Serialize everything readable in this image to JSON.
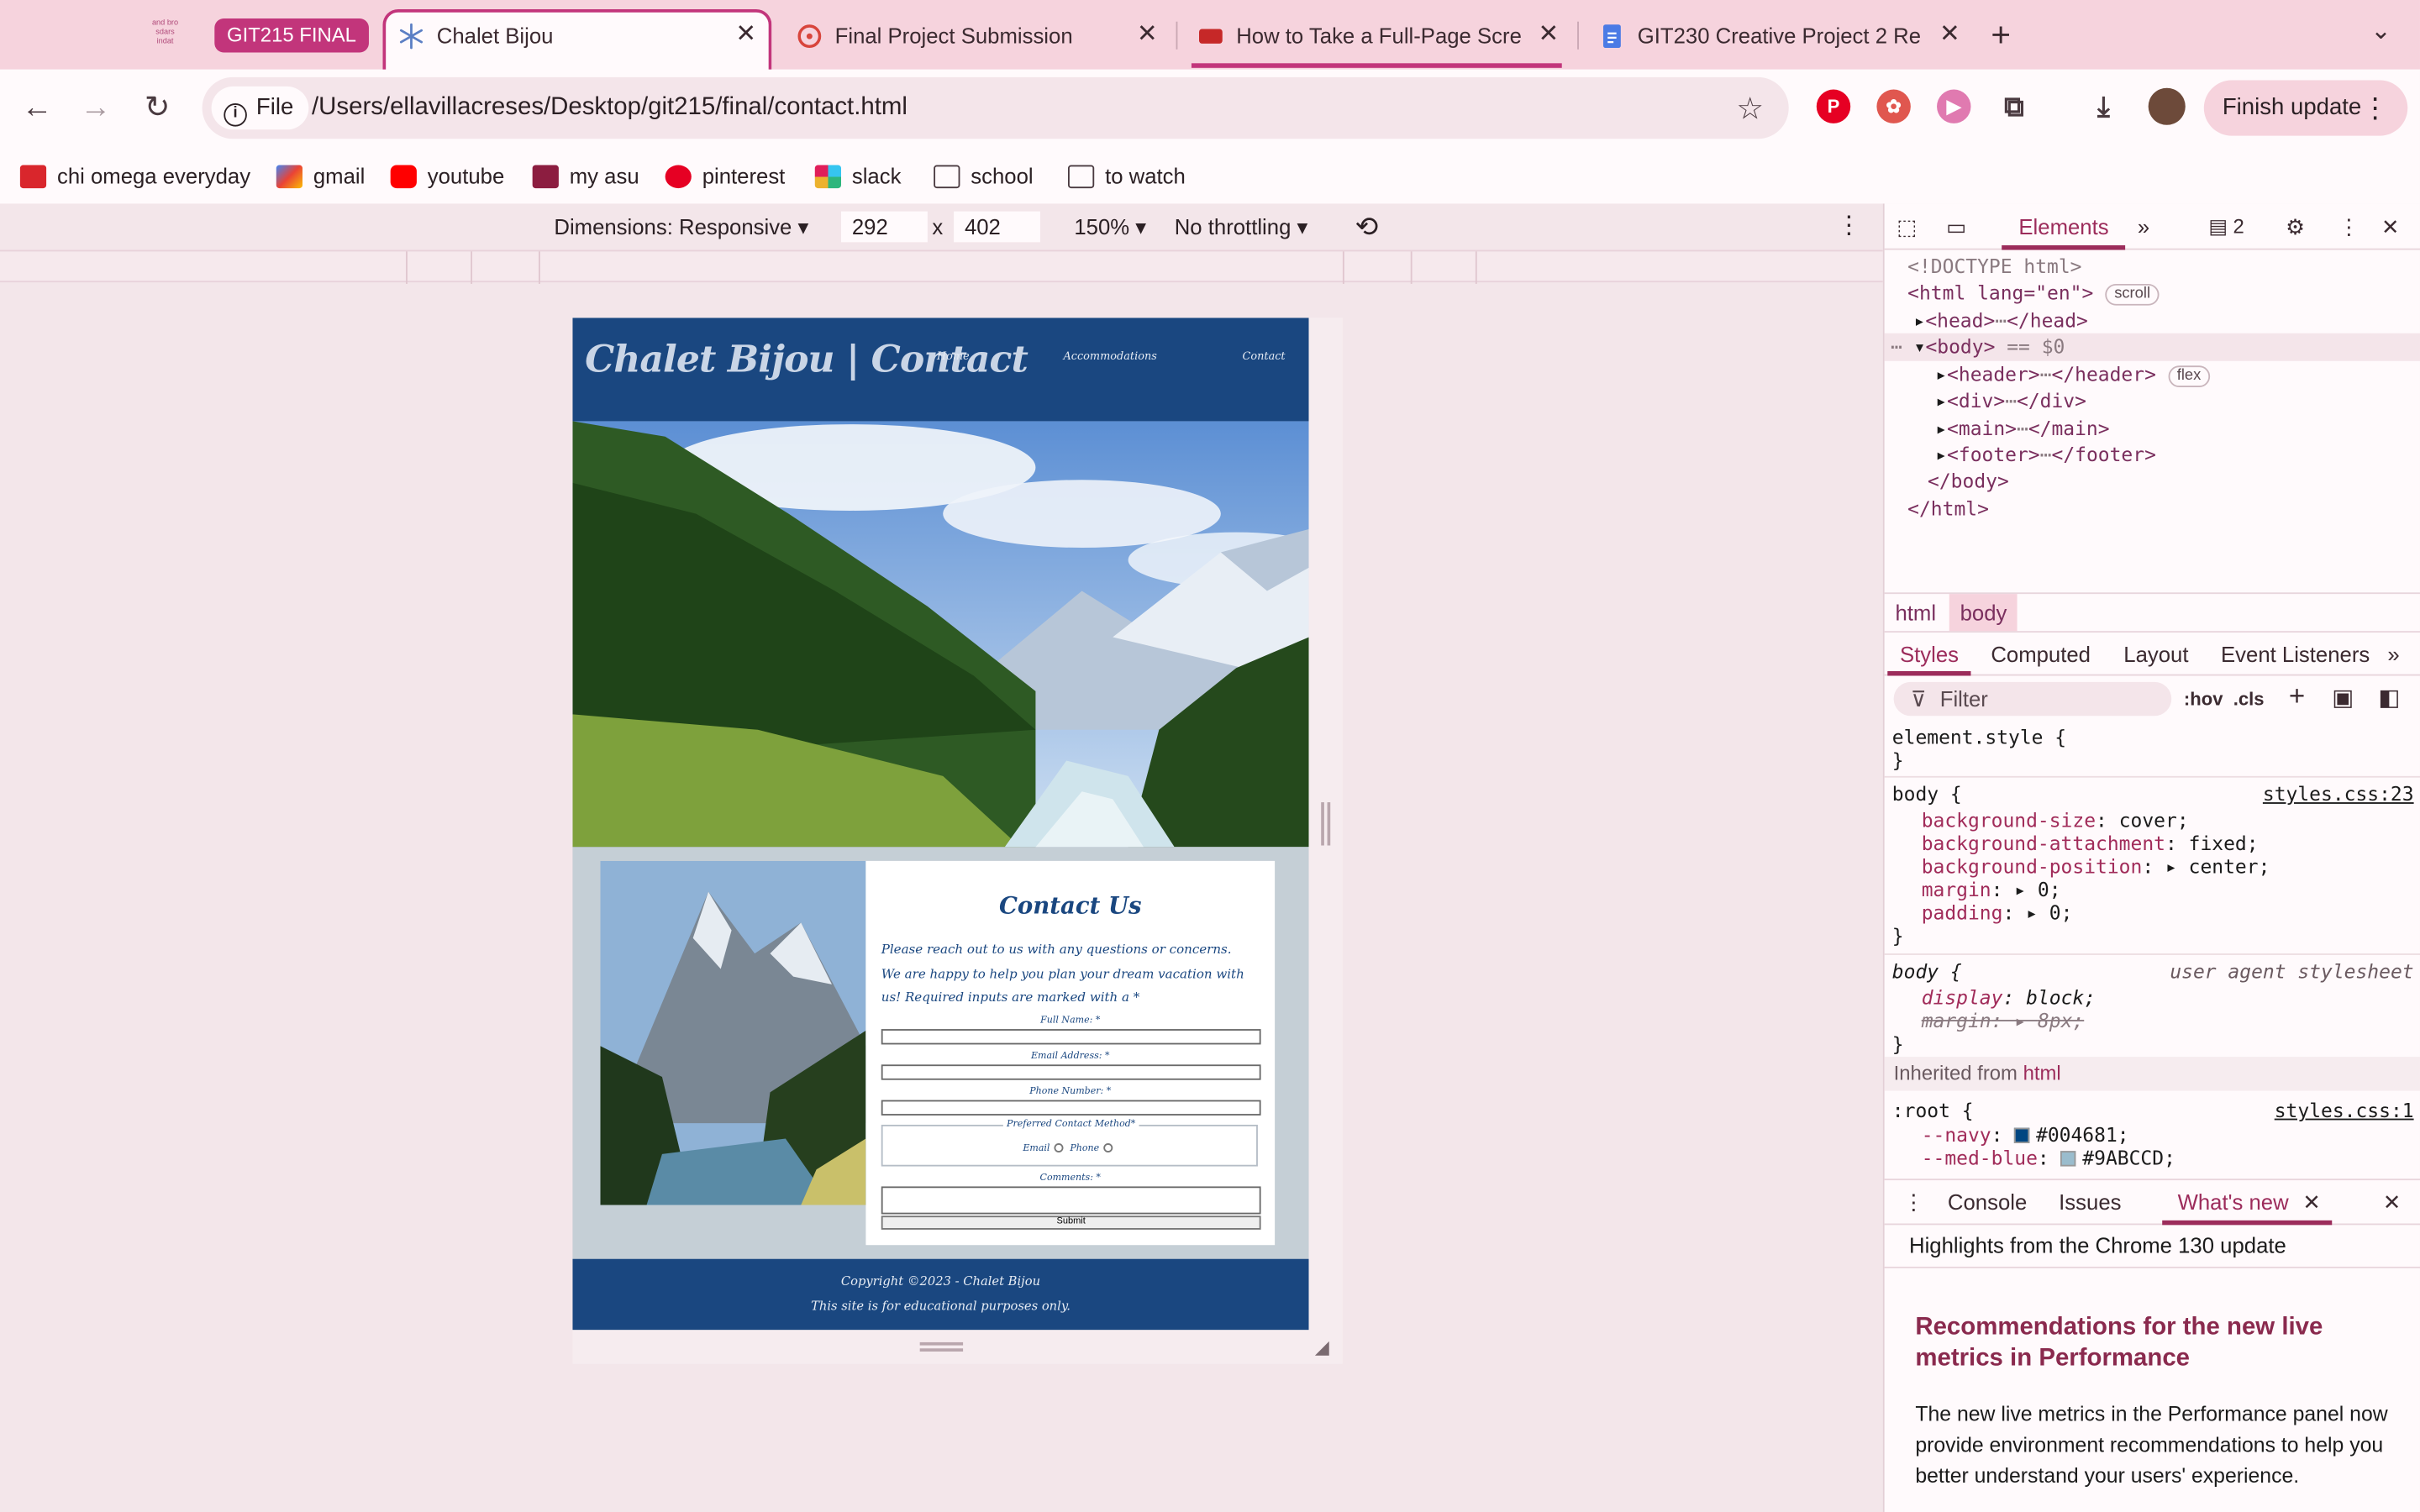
{
  "browser": {
    "tab_group": {
      "logo_text": "and bro sdars indat",
      "label": "GIT215 FINAL"
    },
    "tabs": [
      {
        "title": "Chalet Bijou",
        "active": true
      },
      {
        "title": "Final Project Submission",
        "active": false
      },
      {
        "title": "How to Take a Full-Page Scre",
        "active": false
      },
      {
        "title": "GIT230 Creative Project 2 Re",
        "active": false
      }
    ],
    "new_tab": "+",
    "scheme_chip": "File",
    "url": "/Users/ellavillacreses/Desktop/git215/final/contact.html",
    "finish_update": "Finish update",
    "bookmarks": [
      {
        "label": "chi omega everyday",
        "icon": "chi-omega-icon",
        "color": "#d9262c"
      },
      {
        "label": "gmail",
        "icon": "gmail-icon",
        "color": "#ea4335"
      },
      {
        "label": "youtube",
        "icon": "youtube-icon",
        "color": "#ff0000"
      },
      {
        "label": "my asu",
        "icon": "asu-icon",
        "color": "#8c1d40"
      },
      {
        "label": "pinterest",
        "icon": "pinterest-icon",
        "color": "#e60023"
      },
      {
        "label": "slack",
        "icon": "slack-icon",
        "color": "#4a154b"
      },
      {
        "label": "school",
        "icon": "folder-icon",
        "color": "#4a3a40"
      },
      {
        "label": "to watch",
        "icon": "folder-icon",
        "color": "#4a3a40"
      }
    ]
  },
  "device_toolbar": {
    "dimensions": "Dimensions: Responsive",
    "width": "292",
    "times": "x",
    "height": "402",
    "zoom": "150%",
    "throttling": "No throttling"
  },
  "site": {
    "title": "Chalet Bijou | Contact",
    "nav": [
      "Home",
      "Accommodations",
      "Contact"
    ],
    "form": {
      "heading": "Contact Us",
      "intro": "Please reach out to us with any questions or concerns. We are happy to help you plan your dream vacation with us! Required inputs are marked with a *",
      "fields": [
        "Full Name: *",
        "Email Address: *",
        "Phone Number: *"
      ],
      "method_legend": "Preferred Contact Method*",
      "method_options": [
        "Email",
        "Phone"
      ],
      "comments": "Comments: *",
      "submit": "Submit"
    },
    "footer": [
      "Copyright ©2023 - Chalet Bijou",
      "This site is for educational purposes only."
    ],
    "colors": {
      "navy": "#1a4780",
      "panel": "#c5cfd6"
    }
  },
  "devtools": {
    "tabs": {
      "active": "Elements",
      "more": "»",
      "issues_count": "2"
    },
    "dom": {
      "doctype": "<!DOCTYPE html>",
      "html_open": "<html lang=\"en\">",
      "html_badge": "scroll",
      "head": "<head>",
      "head_close": "</head>",
      "body": "<body>",
      "body_eq": "== $0",
      "children": [
        {
          "open": "<header>",
          "close": "</header>",
          "badge": "flex"
        },
        {
          "open": "<div>",
          "close": "</div>",
          "badge": ""
        },
        {
          "open": "<main>",
          "close": "</main>",
          "badge": ""
        },
        {
          "open": "<footer>",
          "close": "</footer>",
          "badge": ""
        }
      ],
      "body_close": "</body>",
      "html_close": "</html>"
    },
    "breadcrumbs": [
      "html",
      "body"
    ],
    "style_tabs": [
      "Styles",
      "Computed",
      "Layout",
      "Event Listeners"
    ],
    "filter_placeholder": "Filter",
    "hov": ":hov",
    "cls": ".cls",
    "rules": {
      "element_style": "element.style {",
      "body_selector": "body {",
      "body_source": "styles.css:23",
      "body_props": [
        {
          "name": "background-size",
          "value": "cover;"
        },
        {
          "name": "background-attachment",
          "value": "fixed;"
        },
        {
          "name": "background-position",
          "value": "center;"
        },
        {
          "name": "margin",
          "value": "0;"
        },
        {
          "name": "padding",
          "value": "0;"
        }
      ],
      "ua_selector": "body {",
      "ua_source": "user agent stylesheet",
      "ua_display": {
        "name": "display",
        "value": "block;"
      },
      "ua_margin": {
        "name": "margin",
        "value": "8px;"
      },
      "inherited_label": "Inherited from",
      "inherited_tag": "html",
      "root_selector": ":root {",
      "root_source": "styles.css:1",
      "root_vars": [
        {
          "name": "--navy",
          "value": "#004681;",
          "color": "#004681"
        },
        {
          "name": "--med-blue",
          "value": "#9ABCCD;",
          "color": "#9ABCCD"
        }
      ]
    },
    "drawer": {
      "tabs": [
        "Console",
        "Issues",
        "What's new"
      ],
      "header": "Highlights from the Chrome 130 update",
      "title": "Recommendations for the new live metrics in Performance",
      "body": "The new live metrics in the Performance panel now provide environment recommendations to help you better understand your users' experience."
    }
  }
}
